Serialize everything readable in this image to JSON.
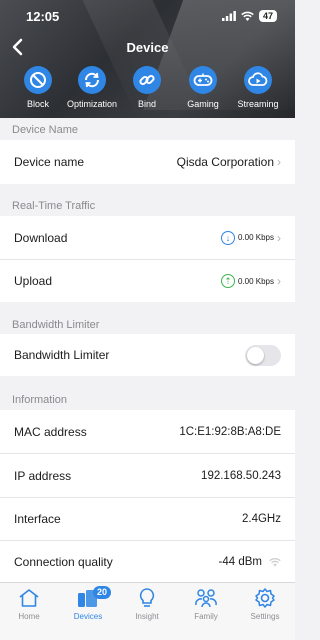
{
  "status": {
    "time": "12:05",
    "battery": "47"
  },
  "header": {
    "title": "Device"
  },
  "actions": [
    {
      "label": "Block",
      "icon": "block-icon"
    },
    {
      "label": "Optimization",
      "icon": "refresh-icon"
    },
    {
      "label": "Bind",
      "icon": "link-icon"
    },
    {
      "label": "Gaming",
      "icon": "gamepad-icon"
    },
    {
      "label": "Streaming",
      "icon": "cloud-play-icon"
    }
  ],
  "sections": {
    "device_name": "Device Name",
    "traffic": "Real-Time Traffic",
    "limiter": "Bandwidth Limiter",
    "information": "Information"
  },
  "device": {
    "label": "Device name",
    "value": "Qisda Corporation"
  },
  "traffic": {
    "download_label": "Download",
    "download_value": "0.00 Kbps",
    "upload_label": "Upload",
    "upload_value": "0.00 Kbps"
  },
  "limiter": {
    "label": "Bandwidth Limiter",
    "enabled": false
  },
  "info": {
    "mac_label": "MAC address",
    "mac_value": "1C:E1:92:8B:A8:DE",
    "ip_label": "IP address",
    "ip_value": "192.168.50.243",
    "interface_label": "Interface",
    "interface_value": "2.4GHz",
    "quality_label": "Connection quality",
    "quality_value": "-44 dBm"
  },
  "tabs": [
    {
      "label": "Home",
      "icon": "home-icon"
    },
    {
      "label": "Devices",
      "icon": "devices-icon",
      "badge": "20",
      "active": true
    },
    {
      "label": "Insight",
      "icon": "lightbulb-icon"
    },
    {
      "label": "Family",
      "icon": "family-icon"
    },
    {
      "label": "Settings",
      "icon": "gear-icon"
    }
  ],
  "colors": {
    "accent": "#2f86e4",
    "download": "#2f86e4",
    "upload": "#3bb54a"
  }
}
